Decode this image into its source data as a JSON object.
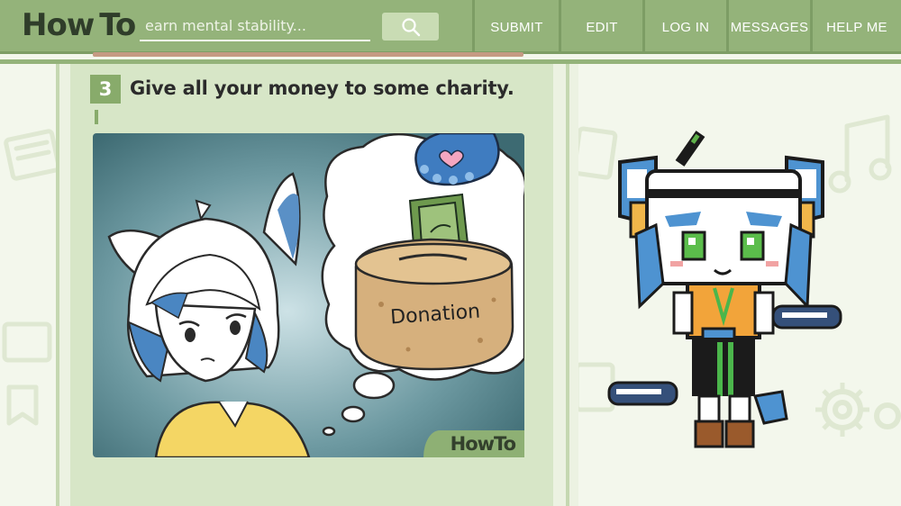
{
  "logo": {
    "how": "How",
    "to": "To"
  },
  "search": {
    "placeholder": "earn mental stability..."
  },
  "nav": {
    "submit": "SUBMIT",
    "edit": "EDIT",
    "login": "LOG IN",
    "messages": "MESSAGES",
    "help": "HELP ME"
  },
  "step": {
    "number": "3",
    "title": "Give all your money to some charity."
  },
  "illustration": {
    "jar_label": "Donation",
    "watermark": "HowTo"
  },
  "colors": {
    "header": "#94b37a",
    "accent": "#88ab6b",
    "page_bg": "#f3f7ec",
    "article_bg": "#d7e6c7"
  },
  "icons": [
    "search-icon",
    "paw-icon",
    "heart-icon",
    "money-bill-icon",
    "gear-icon",
    "music-note-icon",
    "keyboard-icon"
  ]
}
